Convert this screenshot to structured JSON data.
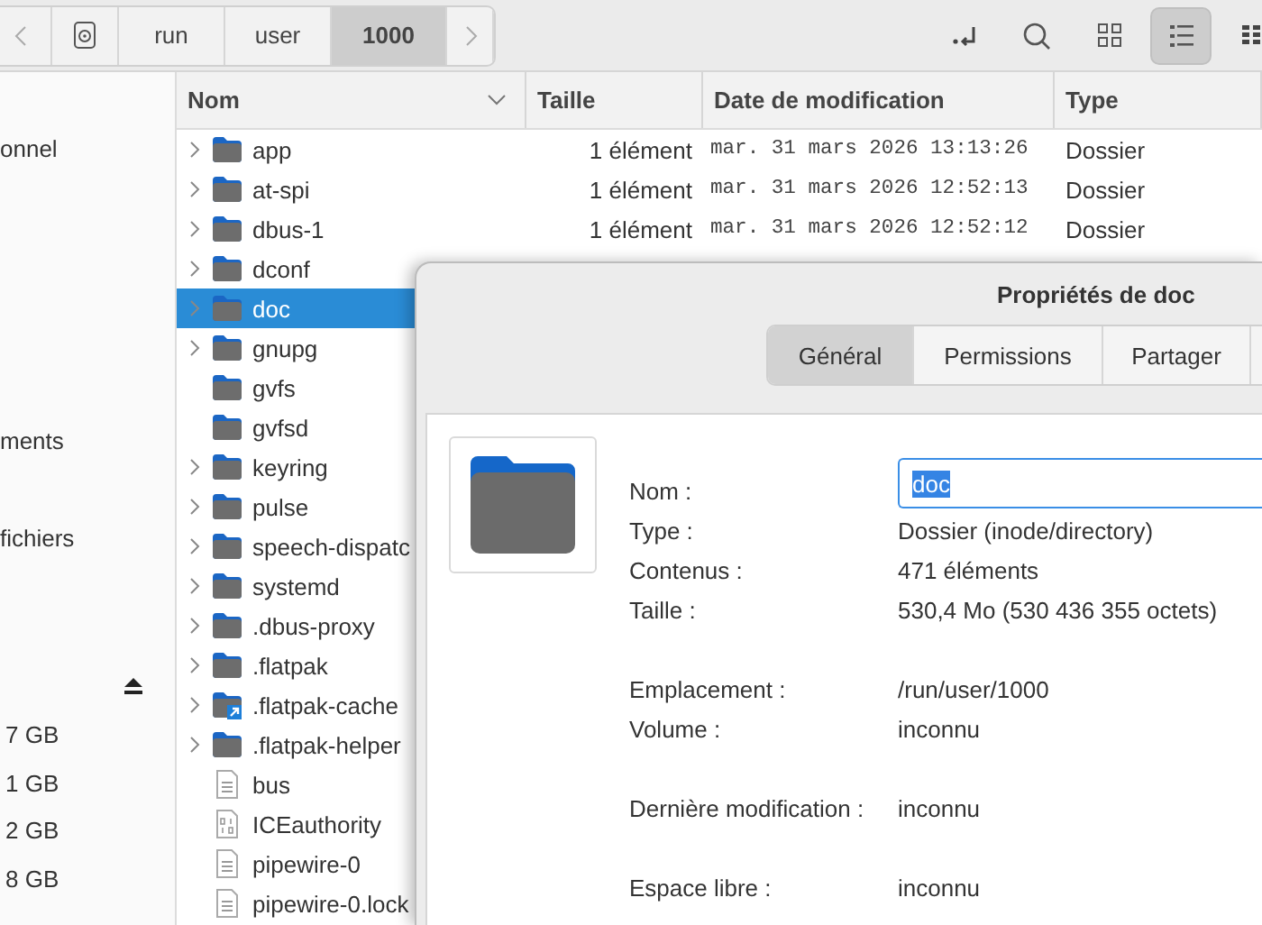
{
  "toolbar": {
    "path": [
      {
        "label": "run",
        "selected": false
      },
      {
        "label": "user",
        "selected": false
      },
      {
        "label": "1000",
        "selected": true
      }
    ],
    "views": [
      {
        "kind": "grid",
        "selected": false
      },
      {
        "kind": "list",
        "selected": true
      }
    ]
  },
  "sidebar": {
    "places": [
      {
        "label": "onnel"
      },
      {
        "label": "ments"
      },
      {
        "label": "fichiers"
      }
    ],
    "devices": [
      {
        "size": "7 GB"
      },
      {
        "size": "1 GB"
      },
      {
        "size": "2 GB"
      },
      {
        "size": "8 GB"
      }
    ]
  },
  "files": {
    "columns": [
      "Nom",
      "Taille",
      "Date de modification",
      "Type"
    ],
    "rows": [
      {
        "name": "app",
        "kind": "folder",
        "expandable": true,
        "selected": false,
        "size": "1 élément",
        "modified": "mar. 31 mars 2026 13:13:26",
        "type": "Dossier"
      },
      {
        "name": "at-spi",
        "kind": "folder",
        "expandable": true,
        "selected": false,
        "size": "1 élément",
        "modified": "mar. 31 mars 2026 12:52:13",
        "type": "Dossier"
      },
      {
        "name": "dbus-1",
        "kind": "folder",
        "expandable": true,
        "selected": false,
        "size": "1 élément",
        "modified": "mar. 31 mars 2026 12:52:12",
        "type": "Dossier"
      },
      {
        "name": "dconf",
        "kind": "folder",
        "expandable": true,
        "selected": false
      },
      {
        "name": "doc",
        "kind": "folder",
        "expandable": true,
        "selected": true
      },
      {
        "name": "gnupg",
        "kind": "folder",
        "expandable": true,
        "selected": false
      },
      {
        "name": "gvfs",
        "kind": "folder",
        "expandable": false,
        "selected": false
      },
      {
        "name": "gvfsd",
        "kind": "folder",
        "expandable": false,
        "selected": false
      },
      {
        "name": "keyring",
        "kind": "folder",
        "expandable": true,
        "selected": false
      },
      {
        "name": "pulse",
        "kind": "folder",
        "expandable": true,
        "selected": false
      },
      {
        "name": "speech-dispatc",
        "kind": "folder",
        "expandable": true,
        "selected": false
      },
      {
        "name": "systemd",
        "kind": "folder",
        "expandable": true,
        "selected": false
      },
      {
        "name": ".dbus-proxy",
        "kind": "folder",
        "expandable": true,
        "selected": false
      },
      {
        "name": ".flatpak",
        "kind": "folder",
        "expandable": true,
        "selected": false
      },
      {
        "name": ".flatpak-cache",
        "kind": "link",
        "expandable": true,
        "selected": false
      },
      {
        "name": ".flatpak-helper",
        "kind": "folder",
        "expandable": true,
        "selected": false
      },
      {
        "name": "bus",
        "kind": "file",
        "expandable": false,
        "selected": false
      },
      {
        "name": "ICEauthority",
        "kind": "binary",
        "expandable": false,
        "selected": false
      },
      {
        "name": "pipewire-0",
        "kind": "file",
        "expandable": false,
        "selected": false
      },
      {
        "name": "pipewire-0.lock",
        "kind": "file",
        "expandable": false,
        "selected": false
      }
    ]
  },
  "dialog": {
    "title": "Propriétés de doc",
    "tabs": [
      {
        "label": "Général",
        "selected": true
      },
      {
        "label": "Permissions",
        "selected": false
      },
      {
        "label": "Partager",
        "selected": false
      }
    ],
    "name_label": "Nom :",
    "name_value": "doc",
    "name_value_selected": true,
    "groups": [
      [
        {
          "label": "Type :",
          "value": "Dossier (inode/directory)"
        },
        {
          "label": "Contenus :",
          "value": "471 éléments"
        },
        {
          "label": "Taille :",
          "value": "530,4 Mo (530 436 355 octets)"
        }
      ],
      [
        {
          "label": "Emplacement :",
          "value": "/run/user/1000"
        },
        {
          "label": "Volume :",
          "value": "inconnu"
        }
      ],
      [
        {
          "label": "Dernière modification :",
          "value": "inconnu"
        }
      ],
      [
        {
          "label": "Espace libre :",
          "value": "inconnu"
        }
      ]
    ]
  }
}
